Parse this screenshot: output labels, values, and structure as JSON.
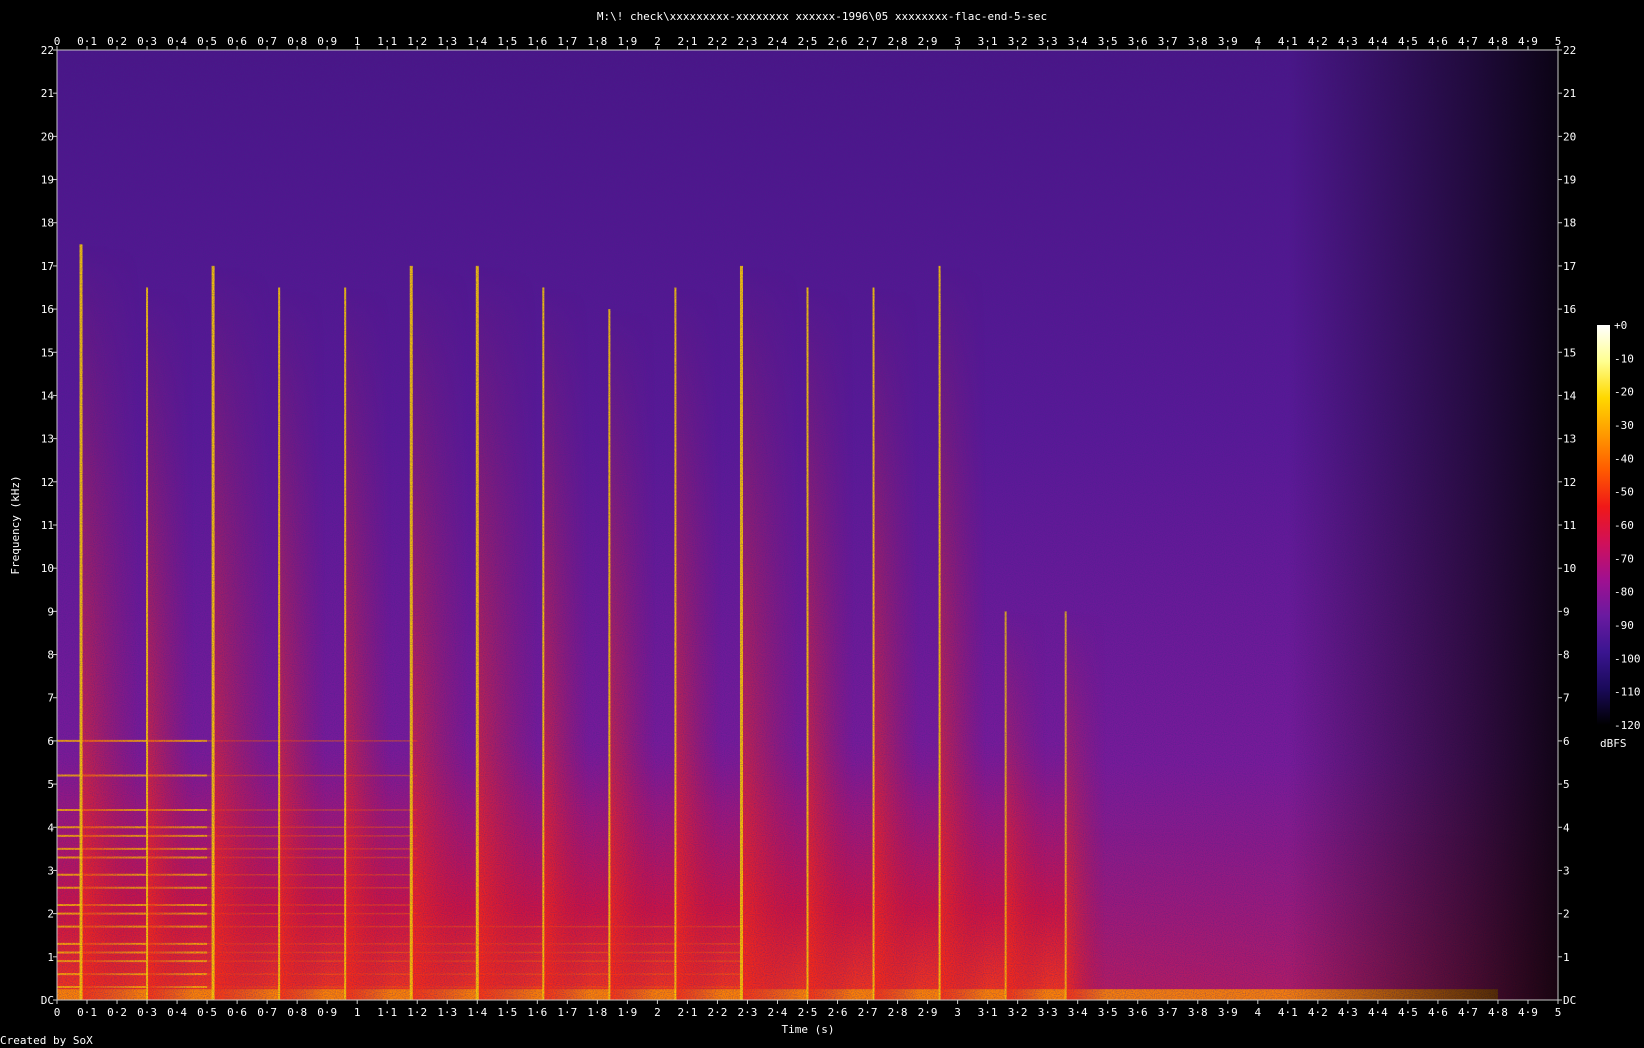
{
  "chart_data": {
    "type": "heatmap",
    "title": "M:\\! check\\xxxxxxxxx-xxxxxxxx xxxxxx-1996\\05 xxxxxxxx-flac-end-5-sec",
    "xlabel": "Time (s)",
    "ylabel": "Frequency (kHz)",
    "xlim": [
      0,
      5
    ],
    "ylim": [
      0,
      22
    ],
    "x_ticks": [
      "0",
      "0·1",
      "0·2",
      "0·3",
      "0·4",
      "0·5",
      "0·6",
      "0·7",
      "0·8",
      "0·9",
      "1",
      "1·1",
      "1·2",
      "1·3",
      "1·4",
      "1·5",
      "1·6",
      "1·7",
      "1·8",
      "1·9",
      "2",
      "2·1",
      "2·2",
      "2·3",
      "2·4",
      "2·5",
      "2·6",
      "2·7",
      "2·8",
      "2·9",
      "3",
      "3·1",
      "3·2",
      "3·3",
      "3·4",
      "3·5",
      "3·6",
      "3·7",
      "3·8",
      "3·9",
      "4",
      "4·1",
      "4·2",
      "4·3",
      "4·4",
      "4·5",
      "4·6",
      "4·7",
      "4·8",
      "4·9",
      "5"
    ],
    "y_ticks": [
      "DC",
      "1",
      "2",
      "3",
      "4",
      "5",
      "6",
      "7",
      "8",
      "9",
      "10",
      "11",
      "12",
      "13",
      "14",
      "15",
      "16",
      "17",
      "18",
      "19",
      "20",
      "21",
      "22"
    ],
    "colorbar": {
      "label": "dBFS",
      "ticks": [
        "+0",
        "-10",
        "-20",
        "-30",
        "-40",
        "-50",
        "-60",
        "-70",
        "-80",
        "-90",
        "-100",
        "-110",
        "-120"
      ],
      "range": [
        -120,
        0
      ],
      "colors": [
        "#000000",
        "#1a0a5a",
        "#3a1590",
        "#6a1aa0",
        "#a01090",
        "#d0105a",
        "#f01818",
        "#ff5a00",
        "#ff9a00",
        "#ffd800",
        "#ffff90",
        "#ffffff"
      ]
    },
    "onsets": [
      {
        "t": 0.08,
        "kind": "strong",
        "top_khz": 17.5
      },
      {
        "t": 0.3,
        "kind": "medium",
        "top_khz": 16.5
      },
      {
        "t": 0.52,
        "kind": "strong",
        "top_khz": 17.0
      },
      {
        "t": 0.74,
        "kind": "medium",
        "top_khz": 16.5
      },
      {
        "t": 0.96,
        "kind": "medium",
        "top_khz": 16.5
      },
      {
        "t": 1.18,
        "kind": "strong",
        "top_khz": 17.0
      },
      {
        "t": 1.4,
        "kind": "strong",
        "top_khz": 17.0
      },
      {
        "t": 1.62,
        "kind": "medium",
        "top_khz": 16.5
      },
      {
        "t": 1.84,
        "kind": "medium",
        "top_khz": 16.0
      },
      {
        "t": 2.06,
        "kind": "medium",
        "top_khz": 16.5
      },
      {
        "t": 2.28,
        "kind": "strong",
        "top_khz": 17.0
      },
      {
        "t": 2.5,
        "kind": "medium",
        "top_khz": 16.5
      },
      {
        "t": 2.72,
        "kind": "medium",
        "top_khz": 16.5
      },
      {
        "t": 2.94,
        "kind": "medium",
        "top_khz": 17.0
      },
      {
        "t": 3.16,
        "kind": "tail",
        "top_khz": 9.0
      },
      {
        "t": 3.36,
        "kind": "tail",
        "top_khz": 9.0
      }
    ],
    "harmonic_bands_khz": [
      0.3,
      0.6,
      0.9,
      1.1,
      1.3,
      1.7,
      2.0,
      2.2,
      2.6,
      2.9,
      3.3,
      3.5,
      3.8,
      4.0,
      4.4,
      5.2,
      6.0
    ],
    "footer": "Created by SoX"
  }
}
